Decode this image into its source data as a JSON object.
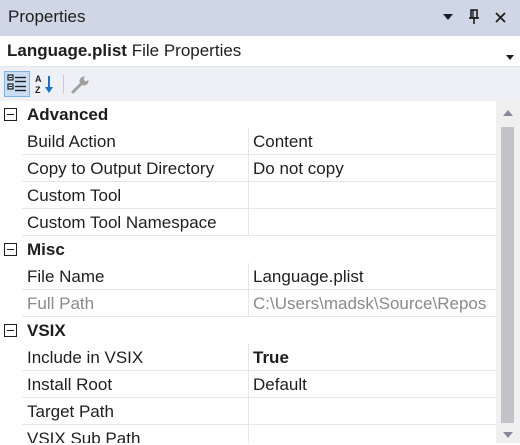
{
  "window": {
    "title": "Properties",
    "dropdown_icon": "dropdown-arrow-icon",
    "pin_icon": "pin-icon",
    "close_icon": "close-icon"
  },
  "object_selector": {
    "file_name": "Language.plist",
    "suffix": "File Properties"
  },
  "toolbar": {
    "categorized_icon": "categorized-icon",
    "alphabetical_icon": "alphabetical-sort-icon",
    "property_pages_icon": "wrench-icon"
  },
  "categories": [
    {
      "name": "Advanced",
      "properties": [
        {
          "name": "Build Action",
          "value": "Content"
        },
        {
          "name": "Copy to Output Directory",
          "value": "Do not copy"
        },
        {
          "name": "Custom Tool",
          "value": ""
        },
        {
          "name": "Custom Tool Namespace",
          "value": ""
        }
      ]
    },
    {
      "name": "Misc",
      "properties": [
        {
          "name": "File Name",
          "value": "Language.plist"
        },
        {
          "name": "Full Path",
          "value": "C:\\Users\\madsk\\Source\\Repos"
        }
      ]
    },
    {
      "name": "VSIX",
      "properties": [
        {
          "name": "Include in VSIX",
          "value": "True"
        },
        {
          "name": "Install Root",
          "value": "Default"
        },
        {
          "name": "Target Path",
          "value": ""
        },
        {
          "name": "VSIX Sub Path",
          "value": ""
        }
      ]
    }
  ],
  "colors": {
    "titlebar": "#cfd6e5",
    "toolbar": "#eef0f5",
    "active_tool": "#c9def5",
    "disabled_text": "#8a8a8a"
  }
}
